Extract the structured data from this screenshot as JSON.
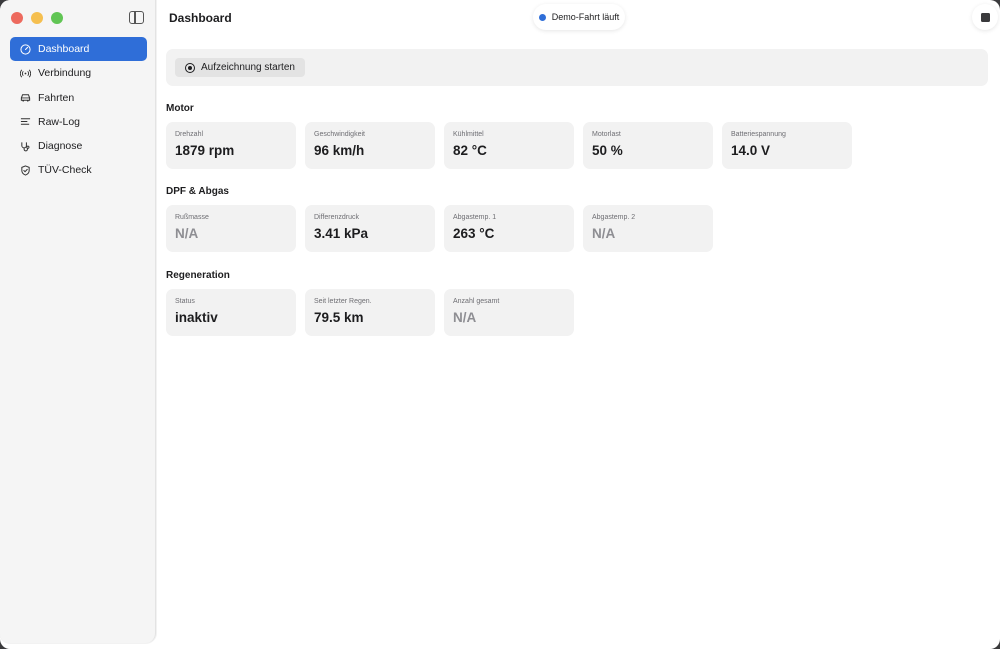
{
  "window": {
    "title": "Dashboard"
  },
  "sidebar": {
    "items": [
      {
        "label": "Dashboard",
        "icon": "gauge-icon",
        "active": true
      },
      {
        "label": "Verbindung",
        "icon": "antenna-icon",
        "active": false
      },
      {
        "label": "Fahrten",
        "icon": "car-icon",
        "active": false
      },
      {
        "label": "Raw-Log",
        "icon": "text-lines-icon",
        "active": false
      },
      {
        "label": "Diagnose",
        "icon": "stethoscope-icon",
        "active": false
      },
      {
        "label": "TÜV-Check",
        "icon": "shield-check-icon",
        "active": false
      }
    ]
  },
  "status": {
    "label": "Demo-Fahrt läuft",
    "dot_color": "#2f6ed8"
  },
  "toolbar": {
    "record_label": "Aufzeichnung starten"
  },
  "sections": {
    "motor": {
      "title": "Motor",
      "cards": [
        {
          "label": "Drehzahl",
          "value": "1879 rpm"
        },
        {
          "label": "Geschwindigkeit",
          "value": "96 km/h"
        },
        {
          "label": "Kühlmittel",
          "value": "82 °C"
        },
        {
          "label": "Motorlast",
          "value": "50 %"
        },
        {
          "label": "Batteriespannung",
          "value": "14.0 V"
        }
      ]
    },
    "dpf": {
      "title": "DPF & Abgas",
      "cards": [
        {
          "label": "Rußmasse",
          "value": "N/A"
        },
        {
          "label": "Differenzdruck",
          "value": "3.41 kPa"
        },
        {
          "label": "Abgastemp. 1",
          "value": "263 °C"
        },
        {
          "label": "Abgastemp. 2",
          "value": "N/A"
        }
      ]
    },
    "regen": {
      "title": "Regeneration",
      "cards": [
        {
          "label": "Status",
          "value": "inaktiv"
        },
        {
          "label": "Seit letzter Regen.",
          "value": "79.5 km"
        },
        {
          "label": "Anzahl gesamt",
          "value": "N/A"
        }
      ]
    }
  },
  "colors": {
    "accent": "#2f6ed8",
    "card_bg": "#f2f2f2",
    "na_text": "#8e8e93"
  }
}
